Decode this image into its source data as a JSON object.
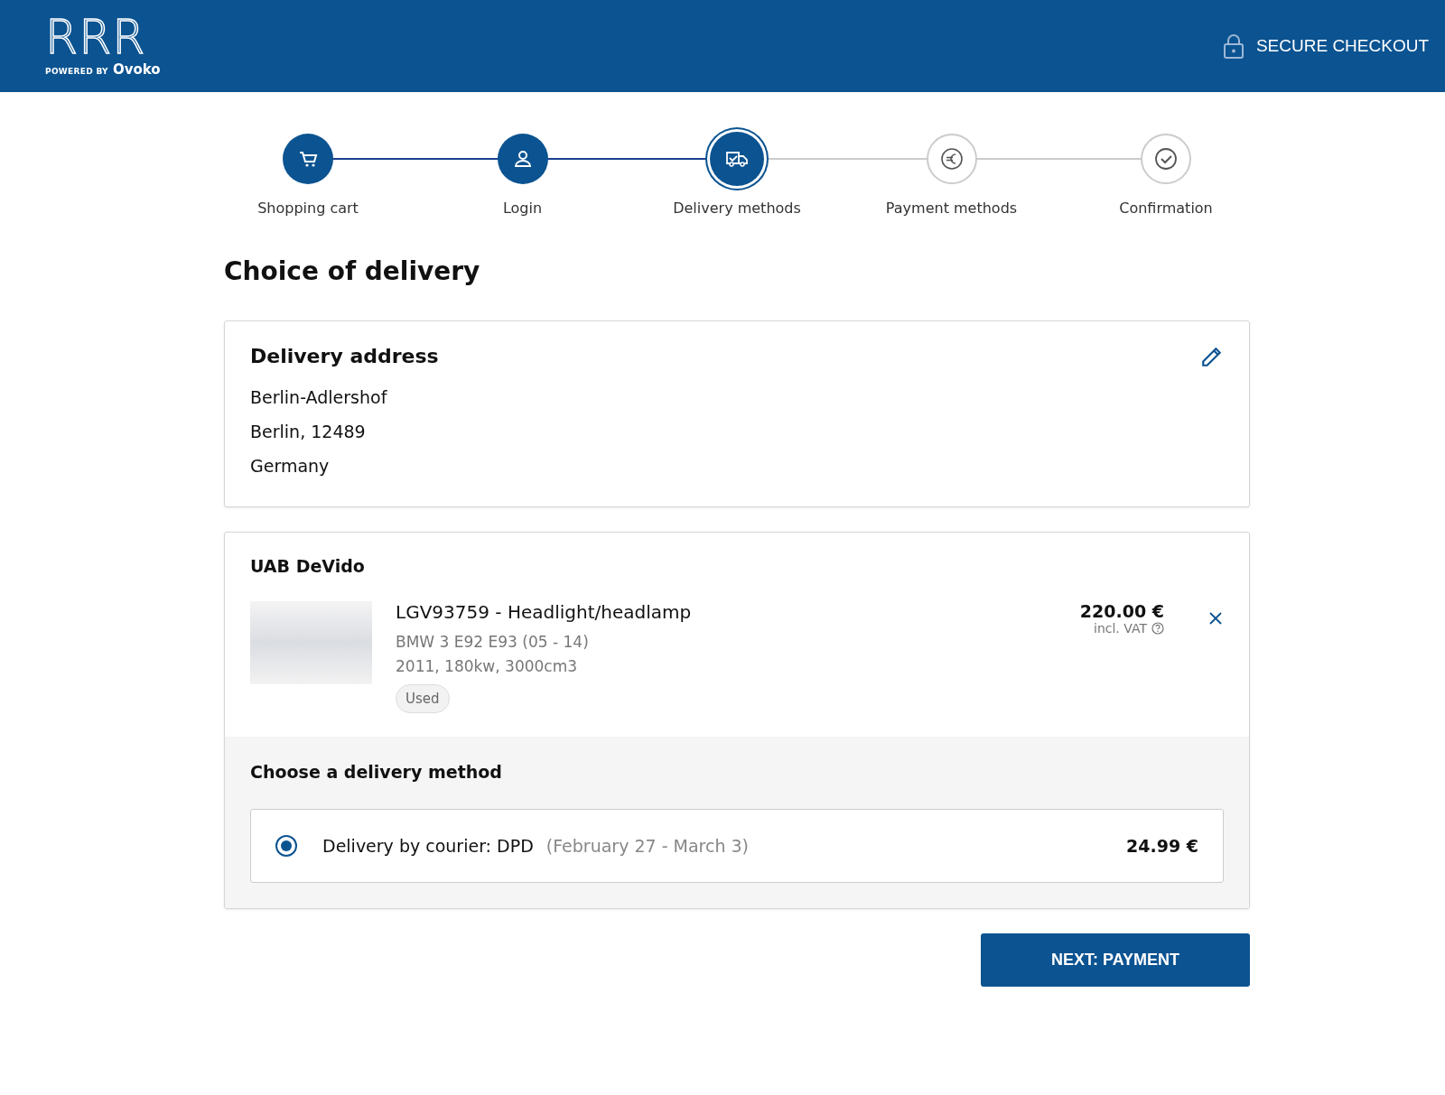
{
  "header": {
    "logo": {
      "mark": "RRR",
      "powered_by": "POWERED BY",
      "brand": "Ovoko"
    },
    "secure_label": "SECURE CHECKOUT"
  },
  "steps": [
    {
      "label": "Shopping cart",
      "completed": true,
      "selected": false
    },
    {
      "label": "Login",
      "completed": true,
      "selected": false
    },
    {
      "label": "Delivery methods",
      "completed": false,
      "selected": true
    },
    {
      "label": "Payment methods",
      "completed": false,
      "selected": false
    },
    {
      "label": "Confirmation",
      "completed": false,
      "selected": false
    }
  ],
  "page_title": "Choice of delivery",
  "address": {
    "title": "Delivery address",
    "lines": [
      "Berlin-Adlershof",
      "Berlin, 12489",
      "Germany"
    ]
  },
  "seller": {
    "name": "UAB DeVido",
    "item": {
      "title": "LGV93759 - Headlight/headlamp",
      "model": "BMW 3 E92 E93 (05 - 14)",
      "specs": "2011, 180kw, 3000cm3",
      "condition": "Used",
      "price": "220.00 €",
      "vat_note": "incl. VAT"
    },
    "delivery_heading": "Choose a delivery method",
    "options": [
      {
        "label": "Delivery by courier: DPD",
        "dates": "(February 27 - March 3)",
        "price": "24.99 €",
        "selected": true
      }
    ]
  },
  "next_button": "NEXT: PAYMENT"
}
